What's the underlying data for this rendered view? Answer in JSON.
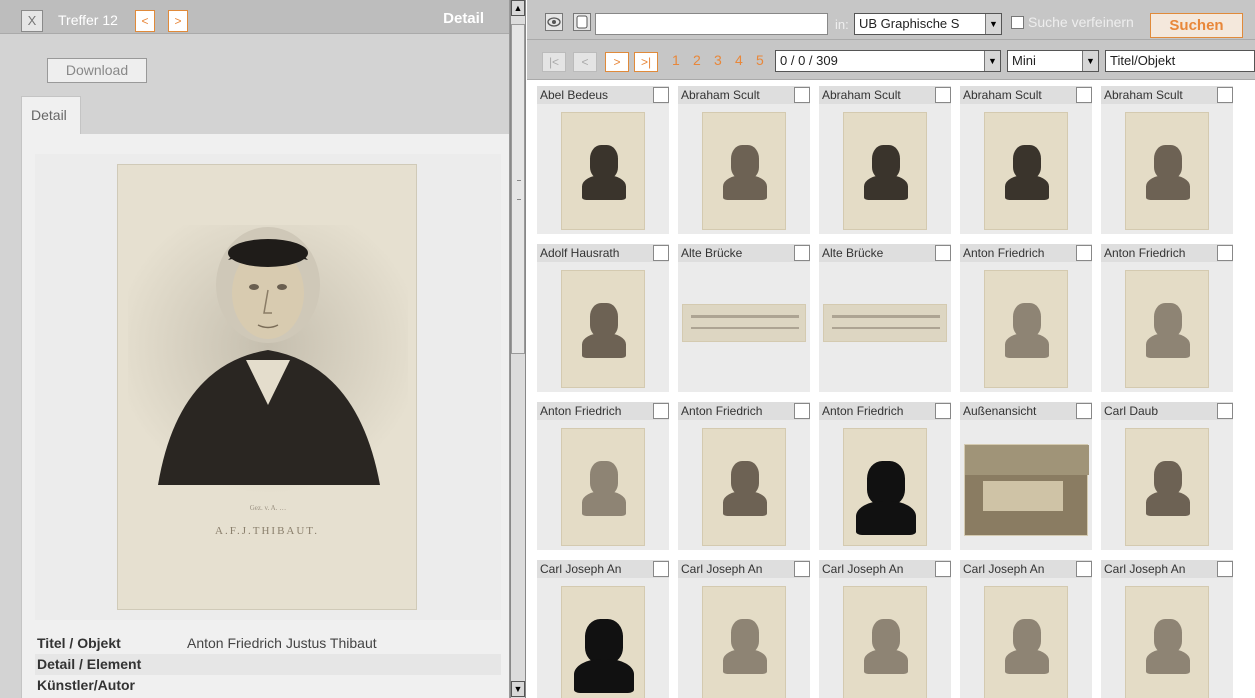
{
  "left": {
    "close_label": "X",
    "hits_label": "Treffer 12",
    "prev_label": "<",
    "next_label": ">",
    "title": "Detail",
    "download_label": "Download",
    "tab_label": "Detail",
    "image_caption": "A.F.J.THIBAUT.",
    "metadata": [
      {
        "label": "Titel / Objekt",
        "value": "Anton Friedrich Justus Thibaut"
      },
      {
        "label": "Detail / Element",
        "value": ""
      },
      {
        "label": "Künstler/Autor",
        "value": ""
      }
    ]
  },
  "toolbar": {
    "search_value": "",
    "in_label": "in:",
    "collection": "UB Graphische S",
    "refine_label": "Suche verfeinern",
    "search_button": "Suchen"
  },
  "pager": {
    "first": "|<",
    "prev": "<",
    "next": ">",
    "last": ">|",
    "pages": [
      "1",
      "2",
      "3",
      "4",
      "5"
    ],
    "count": "0 / 0 / 309",
    "size": "Mini",
    "sort": "Titel/Objekt"
  },
  "grid": [
    {
      "title": "Abel Bedeus",
      "kind": "portrait",
      "tone": "dark"
    },
    {
      "title": "Abraham Scult",
      "kind": "portrait",
      "tone": "mid"
    },
    {
      "title": "Abraham Scult",
      "kind": "portrait",
      "tone": "dark"
    },
    {
      "title": "Abraham Scult",
      "kind": "portrait",
      "tone": "dark"
    },
    {
      "title": "Abraham Scult",
      "kind": "portrait",
      "tone": "mid"
    },
    {
      "title": "Adolf Hausrath",
      "kind": "portrait",
      "tone": "mid"
    },
    {
      "title": "Alte Brücke",
      "kind": "wide",
      "tone": "light"
    },
    {
      "title": "Alte Brücke",
      "kind": "wide",
      "tone": "light"
    },
    {
      "title": "Anton Friedrich",
      "kind": "portrait",
      "tone": "light"
    },
    {
      "title": "Anton Friedrich",
      "kind": "portrait",
      "tone": "light"
    },
    {
      "title": "Anton Friedrich",
      "kind": "portrait",
      "tone": "light"
    },
    {
      "title": "Anton Friedrich",
      "kind": "portrait",
      "tone": "mid"
    },
    {
      "title": "Anton Friedrich",
      "kind": "silhouette",
      "tone": "dark"
    },
    {
      "title": "Außenansicht",
      "kind": "landscape",
      "tone": "mid"
    },
    {
      "title": "Carl Daub",
      "kind": "portrait",
      "tone": "mid"
    },
    {
      "title": "Carl Joseph An",
      "kind": "silhouette",
      "tone": "dark"
    },
    {
      "title": "Carl Joseph An",
      "kind": "portrait",
      "tone": "light"
    },
    {
      "title": "Carl Joseph An",
      "kind": "portrait",
      "tone": "light"
    },
    {
      "title": "Carl Joseph An",
      "kind": "portrait",
      "tone": "light"
    },
    {
      "title": "Carl Joseph An",
      "kind": "portrait",
      "tone": "light"
    }
  ]
}
